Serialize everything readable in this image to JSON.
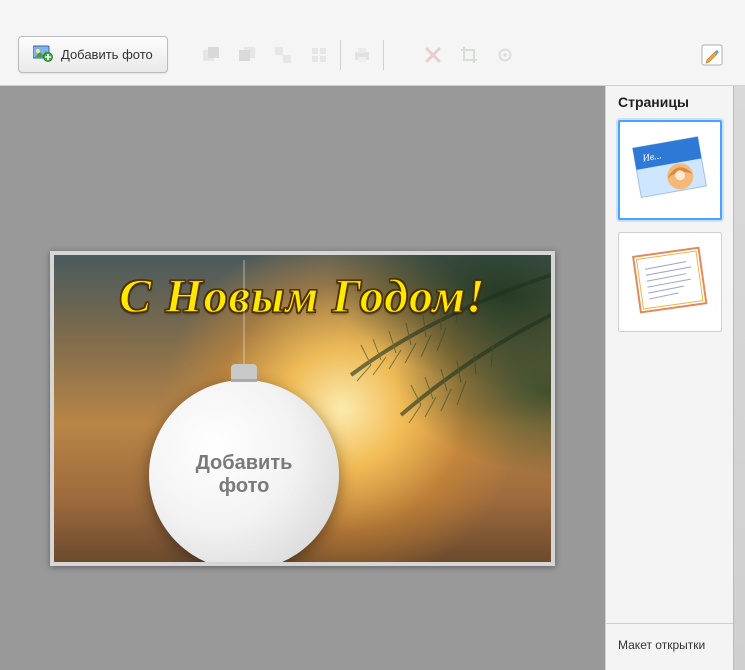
{
  "toolbar": {
    "add_photo_label": "Добавить фото",
    "icons": {
      "add_photo": "add-photo-icon",
      "bring_front": "bring-front-icon",
      "send_back": "send-back-icon",
      "group": "group-icon",
      "align": "align-icon",
      "print": "print-icon",
      "delete": "delete-icon",
      "crop": "crop-icon",
      "settings": "settings-icon",
      "edit": "edit-icon"
    }
  },
  "canvas": {
    "headline": "С Новым Годом!",
    "add_photo_placeholder": "Добавить\nфото"
  },
  "sidepanel": {
    "title": "Страницы",
    "footer_label": "Макет открытки",
    "thumbs": [
      {
        "id": "page-1",
        "selected": true,
        "desc": "postcard-cover-pearl"
      },
      {
        "id": "page-2",
        "selected": false,
        "desc": "postcard-inside-text"
      }
    ]
  },
  "colors": {
    "headline_fill": "#ffe900",
    "headline_stroke": "#5a3900",
    "selection": "#4aa3ff"
  }
}
